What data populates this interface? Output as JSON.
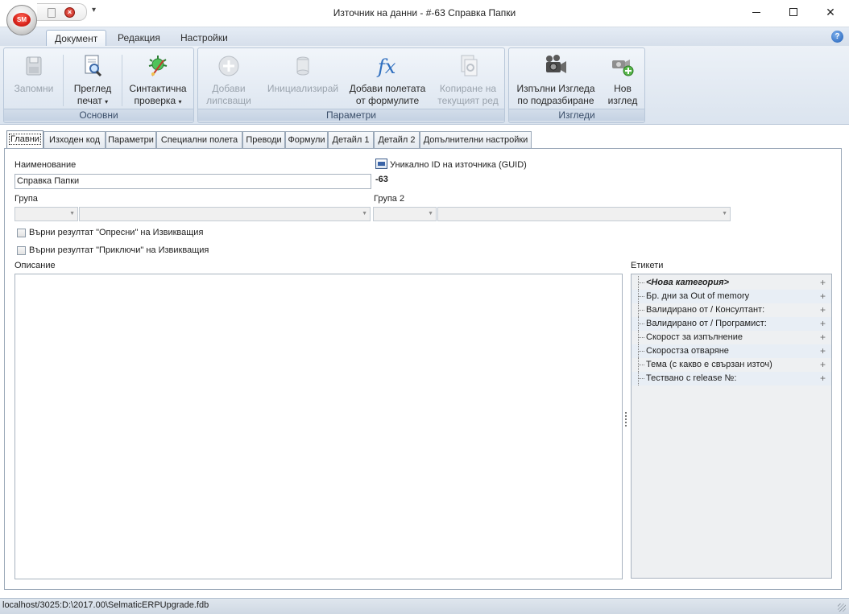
{
  "window": {
    "title": "Източник на данни - #-63 Справка Папки",
    "orb_text": "SM",
    "qat_more": "▾",
    "minimize": "",
    "maximize": "",
    "close": "✕"
  },
  "ribbon_tabs": [
    {
      "label": "Документ",
      "active": true
    },
    {
      "label": "Редакция",
      "active": false
    },
    {
      "label": "Настройки",
      "active": false
    }
  ],
  "help_glyph": "?",
  "ribbon": {
    "groups": [
      {
        "label": "Основни",
        "buttons": [
          {
            "line1": "Запомни",
            "line2": "",
            "enabled": false,
            "icon": "save-icon"
          },
          {
            "line1": "Преглед",
            "line2": "печат",
            "enabled": true,
            "icon": "print-preview-icon",
            "dropdown": true
          },
          {
            "line1": "Синтактична",
            "line2": "проверка",
            "enabled": true,
            "icon": "syntax-check-icon",
            "dropdown": true
          }
        ]
      },
      {
        "label": "Параметри",
        "buttons": [
          {
            "line1": "Добави",
            "line2": "липсващи",
            "enabled": false,
            "icon": "add-missing-icon"
          },
          {
            "line1": "Инициализирай",
            "line2": "",
            "enabled": false,
            "icon": "initialize-icon"
          },
          {
            "line1": "Добави полетата",
            "line2": "от формулите",
            "enabled": true,
            "icon": "fx-icon"
          },
          {
            "line1": "Копиране на",
            "line2": "текущият ред",
            "enabled": false,
            "icon": "copy-row-icon"
          }
        ]
      },
      {
        "label": "Изгледи",
        "buttons": [
          {
            "line1": "Изпълни Изгледа",
            "line2": "по подразбиране",
            "enabled": true,
            "icon": "run-view-icon"
          },
          {
            "line1": "Нов",
            "line2": "изглед",
            "enabled": true,
            "icon": "new-view-icon"
          }
        ]
      }
    ]
  },
  "doc_tabs": [
    {
      "label": "Главни",
      "active": true
    },
    {
      "label": "Изходен код",
      "active": false
    },
    {
      "label": "Параметри",
      "active": false
    },
    {
      "label": "Специални полета",
      "active": false
    },
    {
      "label": "Преводи",
      "active": false
    },
    {
      "label": "Формули",
      "active": false
    },
    {
      "label": "Детайл 1",
      "active": false
    },
    {
      "label": "Детайл 2",
      "active": false
    },
    {
      "label": "Допълнителни настройки",
      "active": false
    }
  ],
  "form": {
    "name_label": "Наименование",
    "name_value": "Справка Папки",
    "guid_label": "Уникално ID на източника (GUID)",
    "guid_value": "-63",
    "group_label": "Група",
    "group2_label": "Група 2",
    "check_refresh_label": "Върни резултат \"Опресни\" на Извикващия",
    "check_refresh_checked": false,
    "check_finish_label": "Върни резултат \"Приключи\" на Извикващия",
    "check_finish_checked": false,
    "description_label": "Описание",
    "description_value": ""
  },
  "tags": {
    "label": "Етикети",
    "items": [
      {
        "text": "<Нова категория>",
        "new": true
      },
      {
        "text": "Бр. дни за Out of memory"
      },
      {
        "text": "Валидирано от / Консултант:"
      },
      {
        "text": "Валидирано от / Програмист:"
      },
      {
        "text": "Скорост за изпълнение"
      },
      {
        "text": "Скоростза отваряне"
      },
      {
        "text": "Тема (с какво е свързан източ)"
      },
      {
        "text": "Тествано с release №:"
      }
    ],
    "plus_glyph": "+"
  },
  "status": {
    "text": "localhost/3025:D:\\2017.00\\SelmaticERPUpgrade.fdb"
  }
}
